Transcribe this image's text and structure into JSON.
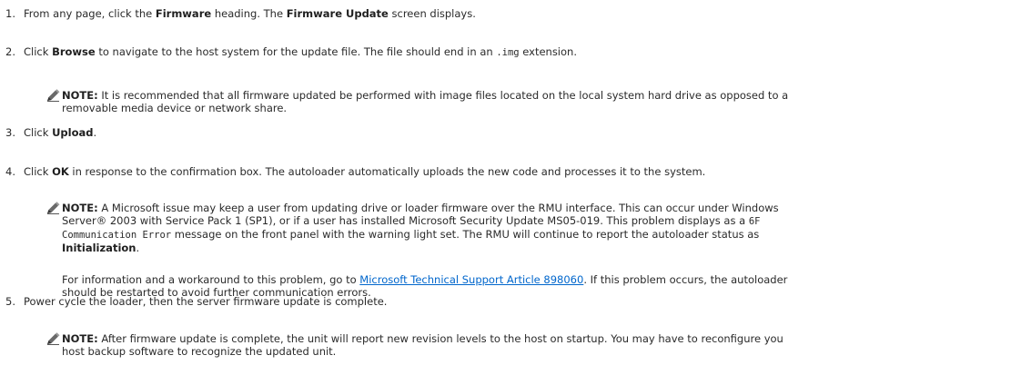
{
  "steps": [
    {
      "num": "1.",
      "parts": [
        {
          "t": "From any page, click the ",
          "b": false
        },
        {
          "t": "Firmware",
          "b": true
        },
        {
          "t": " heading. The ",
          "b": false
        },
        {
          "t": "Firmware Update",
          "b": true
        },
        {
          "t": " screen displays.",
          "b": false
        }
      ]
    },
    {
      "num": "2.",
      "parts": [
        {
          "t": "Click ",
          "b": false
        },
        {
          "t": "Browse",
          "b": true
        },
        {
          "t": " to navigate to the host system for the update file. The file should end in an ",
          "b": false
        },
        {
          "t": ".img",
          "mono": true
        },
        {
          "t": " extension.",
          "b": false
        }
      ]
    },
    {
      "num": "3.",
      "parts": [
        {
          "t": "Click ",
          "b": false
        },
        {
          "t": "Upload",
          "b": true
        },
        {
          "t": ".",
          "b": false
        }
      ]
    },
    {
      "num": "4.",
      "parts": [
        {
          "t": "Click ",
          "b": false
        },
        {
          "t": "OK",
          "b": true
        },
        {
          "t": " in response to the confirmation box. The autoloader automatically uploads the new code and processes it to the system.",
          "b": false
        }
      ]
    },
    {
      "num": "5.",
      "parts": [
        {
          "t": "Power cycle the loader, then the server firmware update is complete.",
          "b": false
        }
      ]
    }
  ],
  "notes": {
    "note1": {
      "label": "NOTE:",
      "line1": " It is recommended that all firmware updated be performed with image files located on the local system hard drive as opposed to a",
      "line2": "removable media device or network share."
    },
    "note2": {
      "label": "NOTE:",
      "line1": " A Microsoft issue may keep a user from updating drive or loader firmware over the RMU interface. This can occur under Windows",
      "line2": "Server® 2003 with Service Pack 1 (SP1), or if a user has installed Microsoft Security Update MS05-019. This problem displays as a ",
      "code1": "6F",
      "code2": "Communication Error",
      "line3": " message on the front panel with the warning light set. The RMU will continue to report the autoloader status as",
      "bold_status": "Initialization",
      "period": "."
    },
    "note2_followup": {
      "pre": "For information and a workaround to this problem, go to ",
      "link": "Microsoft Technical Support Article 898060",
      "post": ". If this problem occurs, the autoloader",
      "line2": "should be restarted to avoid further communication errors."
    },
    "note3": {
      "label": "NOTE:",
      "line1": " After firmware update is complete, the unit will report new revision levels to the host on startup. You may have to reconfigure you",
      "line2": "host backup software to recognize the updated unit."
    }
  },
  "icons": {
    "note_icon": "pencil-note-icon"
  }
}
